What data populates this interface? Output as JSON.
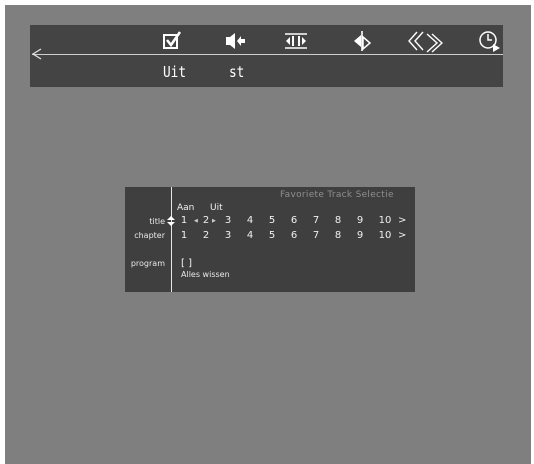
{
  "menubar": {
    "icons": [
      "checkbox-icon",
      "speaker-icon",
      "ab-repeat-icon",
      "shuffle-icon",
      "scan-icon",
      "timer-icon"
    ],
    "labels": {
      "check": "Uit",
      "speaker": "st"
    }
  },
  "panel": {
    "title": "Favoriete Track Selectie",
    "headers": {
      "on": "Aan",
      "off": "Uit"
    },
    "rows": {
      "title": {
        "label": "title",
        "numbers": [
          "1",
          "2",
          "3",
          "4",
          "5",
          "6",
          "7",
          "8",
          "9",
          "10"
        ]
      },
      "chapter": {
        "label": "chapter",
        "numbers": [
          "1",
          "2",
          "3",
          "4",
          "5",
          "6",
          "7",
          "8",
          "9",
          "10"
        ]
      },
      "program": {
        "label": "program",
        "value": "[ ]",
        "text": "Alles wissen"
      }
    },
    "more_arrow": ">"
  }
}
